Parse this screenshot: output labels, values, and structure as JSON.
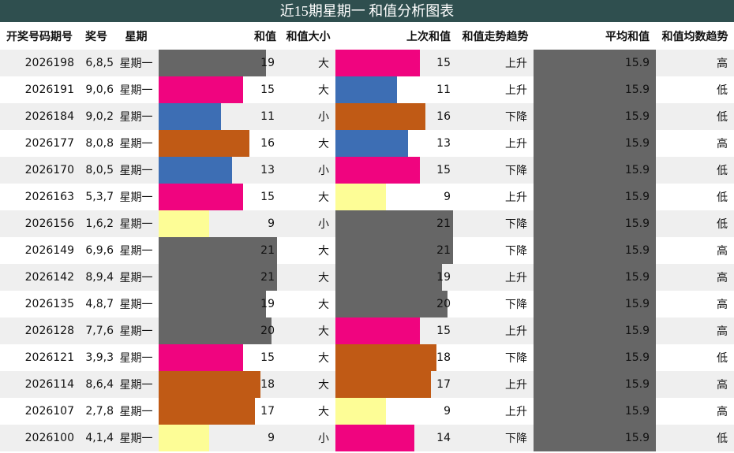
{
  "title": "近15期星期一 和值分析图表",
  "headers": {
    "issue": "开奖号码期号",
    "numbers": "奖号",
    "weekday": "星期",
    "sum": "和值",
    "size": "和值大小",
    "prev_sum": "上次和值",
    "trend": "和值走势趋势",
    "avg": "平均和值",
    "avg_trend": "和值均数趋势"
  },
  "colors": {
    "9": "#fdfd96",
    "11": "#3d6eb4",
    "13": "#3d6eb4",
    "15": "#f0047f",
    "16": "#c05a15",
    "17": "#c05a15",
    "18": "#c05a15",
    "14": "#f0047f",
    "19": "#666666",
    "20": "#666666",
    "21": "#666666"
  },
  "rows": [
    {
      "issue": "2026198",
      "numbers": "6,8,5",
      "weekday": "星期一",
      "sum": 19,
      "size": "大",
      "prev": 15,
      "trend": "上升",
      "avg": "15.9",
      "avg_trend": "高"
    },
    {
      "issue": "2026191",
      "numbers": "9,0,6",
      "weekday": "星期一",
      "sum": 15,
      "size": "大",
      "prev": 11,
      "trend": "上升",
      "avg": "15.9",
      "avg_trend": "低"
    },
    {
      "issue": "2026184",
      "numbers": "9,0,2",
      "weekday": "星期一",
      "sum": 11,
      "size": "小",
      "prev": 16,
      "trend": "下降",
      "avg": "15.9",
      "avg_trend": "低"
    },
    {
      "issue": "2026177",
      "numbers": "8,0,8",
      "weekday": "星期一",
      "sum": 16,
      "size": "大",
      "prev": 13,
      "trend": "上升",
      "avg": "15.9",
      "avg_trend": "高"
    },
    {
      "issue": "2026170",
      "numbers": "8,0,5",
      "weekday": "星期一",
      "sum": 13,
      "size": "小",
      "prev": 15,
      "trend": "下降",
      "avg": "15.9",
      "avg_trend": "低"
    },
    {
      "issue": "2026163",
      "numbers": "5,3,7",
      "weekday": "星期一",
      "sum": 15,
      "size": "大",
      "prev": 9,
      "trend": "上升",
      "avg": "15.9",
      "avg_trend": "低"
    },
    {
      "issue": "2026156",
      "numbers": "1,6,2",
      "weekday": "星期一",
      "sum": 9,
      "size": "小",
      "prev": 21,
      "trend": "下降",
      "avg": "15.9",
      "avg_trend": "低"
    },
    {
      "issue": "2026149",
      "numbers": "6,9,6",
      "weekday": "星期一",
      "sum": 21,
      "size": "大",
      "prev": 21,
      "trend": "下降",
      "avg": "15.9",
      "avg_trend": "高"
    },
    {
      "issue": "2026142",
      "numbers": "8,9,4",
      "weekday": "星期一",
      "sum": 21,
      "size": "大",
      "prev": 19,
      "trend": "上升",
      "avg": "15.9",
      "avg_trend": "高"
    },
    {
      "issue": "2026135",
      "numbers": "4,8,7",
      "weekday": "星期一",
      "sum": 19,
      "size": "大",
      "prev": 20,
      "trend": "下降",
      "avg": "15.9",
      "avg_trend": "高"
    },
    {
      "issue": "2026128",
      "numbers": "7,7,6",
      "weekday": "星期一",
      "sum": 20,
      "size": "大",
      "prev": 15,
      "trend": "上升",
      "avg": "15.9",
      "avg_trend": "高"
    },
    {
      "issue": "2026121",
      "numbers": "3,9,3",
      "weekday": "星期一",
      "sum": 15,
      "size": "大",
      "prev": 18,
      "trend": "下降",
      "avg": "15.9",
      "avg_trend": "低"
    },
    {
      "issue": "2026114",
      "numbers": "8,6,4",
      "weekday": "星期一",
      "sum": 18,
      "size": "大",
      "prev": 17,
      "trend": "上升",
      "avg": "15.9",
      "avg_trend": "高"
    },
    {
      "issue": "2026107",
      "numbers": "2,7,8",
      "weekday": "星期一",
      "sum": 17,
      "size": "大",
      "prev": 9,
      "trend": "上升",
      "avg": "15.9",
      "avg_trend": "高"
    },
    {
      "issue": "2026100",
      "numbers": "4,1,4",
      "weekday": "星期一",
      "sum": 9,
      "size": "小",
      "prev": 14,
      "trend": "下降",
      "avg": "15.9",
      "avg_trend": "低"
    }
  ]
}
